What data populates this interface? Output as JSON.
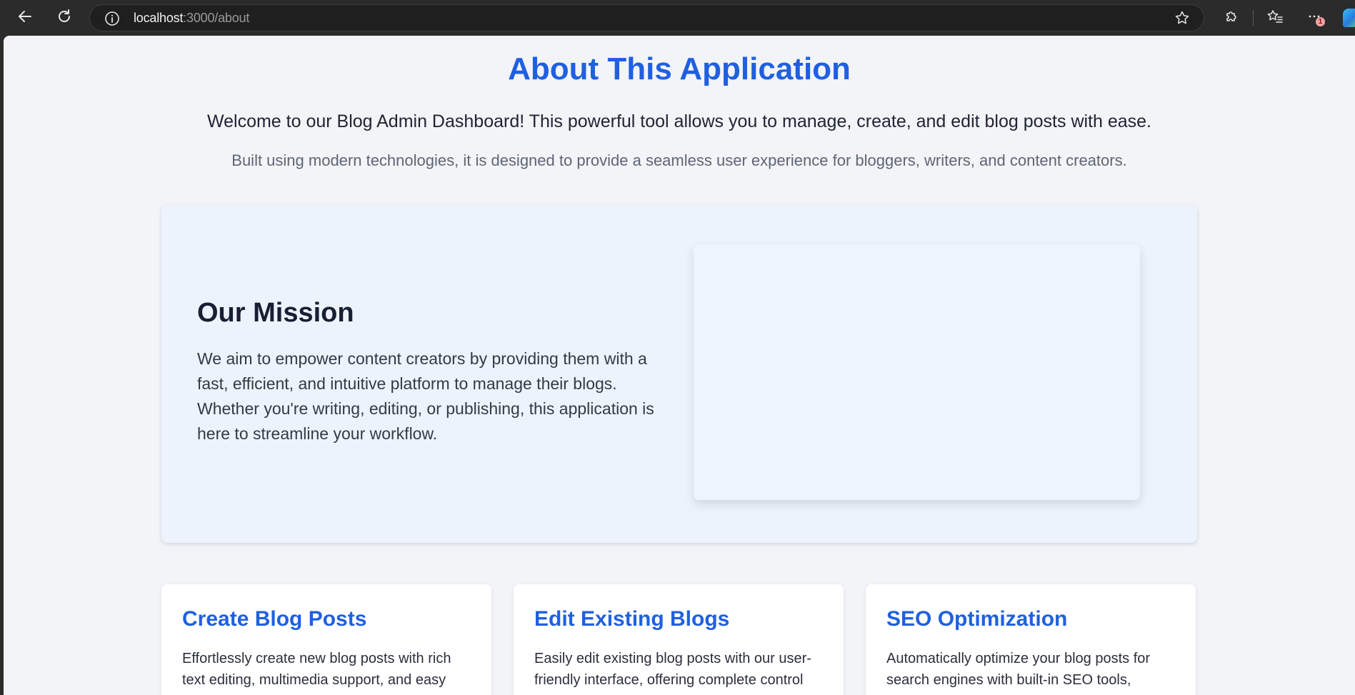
{
  "browser": {
    "url_host": "localhost",
    "url_path": ":3000/about",
    "notification_count": "1"
  },
  "page": {
    "title": "About This Application",
    "intro": "Welcome to our Blog Admin Dashboard! This powerful tool allows you to manage, create, and edit blog posts with ease.",
    "subintro": "Built using modern technologies, it is designed to provide a seamless user experience for bloggers, writers, and content creators."
  },
  "mission": {
    "heading": "Our Mission",
    "text": "We aim to empower content creators by providing them with a fast, efficient, and intuitive platform to manage their blogs. Whether you're writing, editing, or publishing, this application is here to streamline your workflow."
  },
  "features": [
    {
      "title": "Create Blog Posts",
      "description": "Effortlessly create new blog posts with rich text editing, multimedia support, and easy"
    },
    {
      "title": "Edit Existing Blogs",
      "description": "Easily edit existing blog posts with our user-friendly interface, offering complete control"
    },
    {
      "title": "SEO Optimization",
      "description": "Automatically optimize your blog posts for search engines with built-in SEO tools,"
    }
  ],
  "colors": {
    "accent": "#1f60e0",
    "page_bg": "#f3f4f8",
    "mission_bg": "#edf3fd",
    "chrome_bg": "#2b2b2b"
  }
}
